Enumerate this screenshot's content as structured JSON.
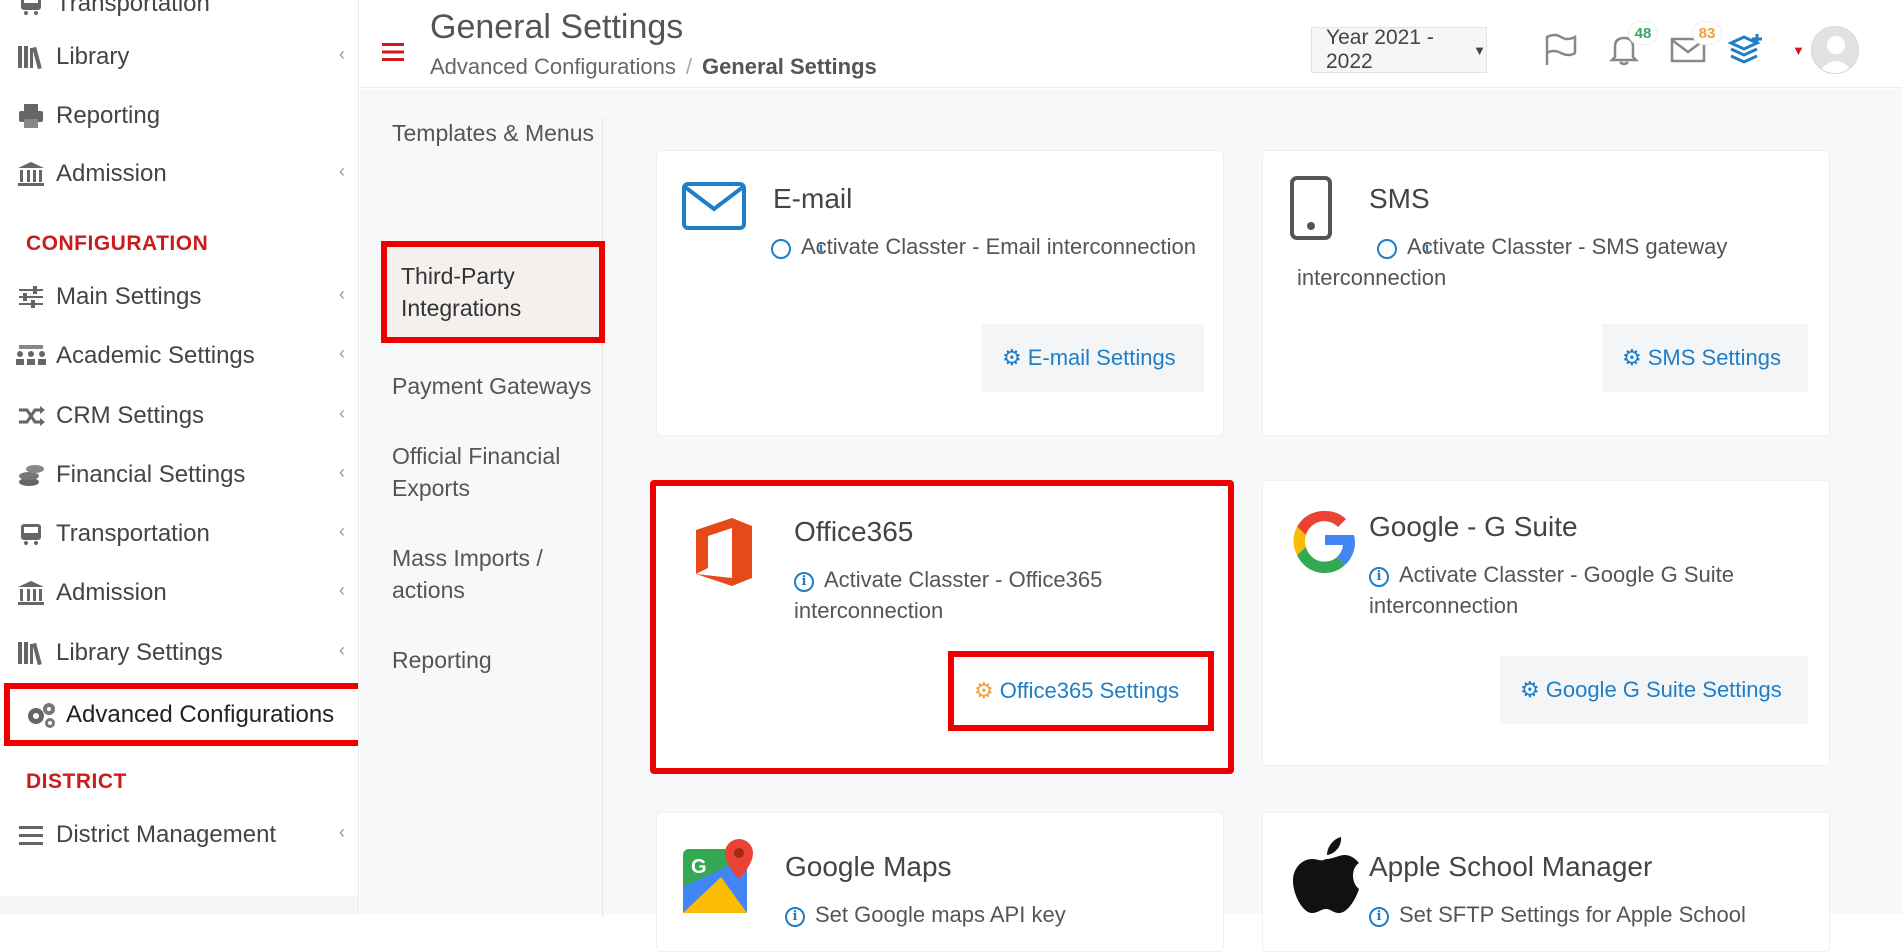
{
  "sidebar": {
    "items": [
      {
        "label": "Transportation",
        "icon": "bus-icon"
      },
      {
        "label": "Library",
        "icon": "library-icon"
      },
      {
        "label": "Reporting",
        "icon": "printer-icon"
      },
      {
        "label": "Admission",
        "icon": "institution-icon"
      },
      {
        "label": "Main Settings",
        "icon": "sliders-icon"
      },
      {
        "label": "Academic Settings",
        "icon": "classroom-icon"
      },
      {
        "label": "CRM Settings",
        "icon": "shuffle-icon"
      },
      {
        "label": "Financial Settings",
        "icon": "coins-icon"
      },
      {
        "label": "Transportation",
        "icon": "bus-icon"
      },
      {
        "label": "Admission",
        "icon": "institution-icon"
      },
      {
        "label": "Library Settings",
        "icon": "library-icon"
      },
      {
        "label": "Advanced Configurations",
        "icon": "gears-icon"
      },
      {
        "label": "District Management",
        "icon": "list-icon"
      }
    ],
    "sections": {
      "configuration": "CONFIGURATION",
      "district": "DISTRICT"
    }
  },
  "header": {
    "title": "General Settings",
    "breadcrumb": [
      "Advanced Configurations",
      "/",
      "General Settings"
    ],
    "year_select": "Year 2021 - 2022",
    "notifications_count": "48",
    "messages_count": "83"
  },
  "subnav": {
    "items": [
      "Templates & Menus",
      "Third-Party Integrations",
      "Payment Gateways",
      "Official Financial Exports",
      "Mass Imports / actions",
      "Reporting"
    ]
  },
  "cards": [
    {
      "title": "E-mail",
      "desc": "Activate Classter - Email interconnection",
      "button": "E-mail Settings",
      "icon": "envelope-icon"
    },
    {
      "title": "SMS",
      "desc": "Activate Classter - SMS gateway interconnection",
      "button": "SMS Settings",
      "icon": "mobile-phone-icon"
    },
    {
      "title": "Office365",
      "desc": "Activate Classter - Office365 interconnection",
      "button": "Office365 Settings",
      "icon": "office365-logo-icon"
    },
    {
      "title": "Google - G Suite",
      "desc": "Activate Classter - Google G Suite interconnection",
      "button": "Google G Suite Settings",
      "icon": "google-logo-icon"
    },
    {
      "title": "Google Maps",
      "desc": "Set Google maps API key",
      "icon": "google-maps-icon"
    },
    {
      "title": "Apple School Manager",
      "desc": "Set SFTP Settings for Apple School",
      "icon": "apple-logo-icon"
    }
  ],
  "colors": {
    "accent": "#1f7ec6",
    "highlight": "#ee0000",
    "section": "#cc1b1b"
  }
}
